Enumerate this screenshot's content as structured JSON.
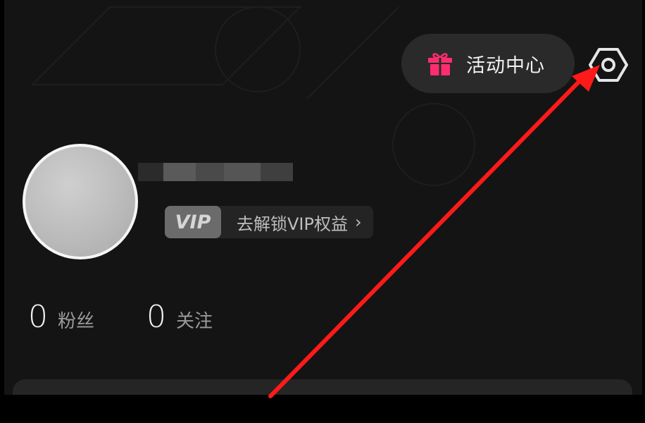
{
  "header": {
    "event_center_label": "活动中心",
    "event_icon": "gift-icon",
    "settings_icon": "settings-hexagon-icon",
    "accent_color": "#ff2d6f"
  },
  "profile": {
    "avatar_icon": "avatar",
    "vip": {
      "badge": "VIP",
      "text": "去解锁VIP权益",
      "chevron": "›"
    },
    "stats": [
      {
        "value": "0",
        "label": "粉丝"
      },
      {
        "value": "0",
        "label": "关注"
      }
    ]
  },
  "annotation": {
    "arrow_color": "#ff1a1a"
  }
}
